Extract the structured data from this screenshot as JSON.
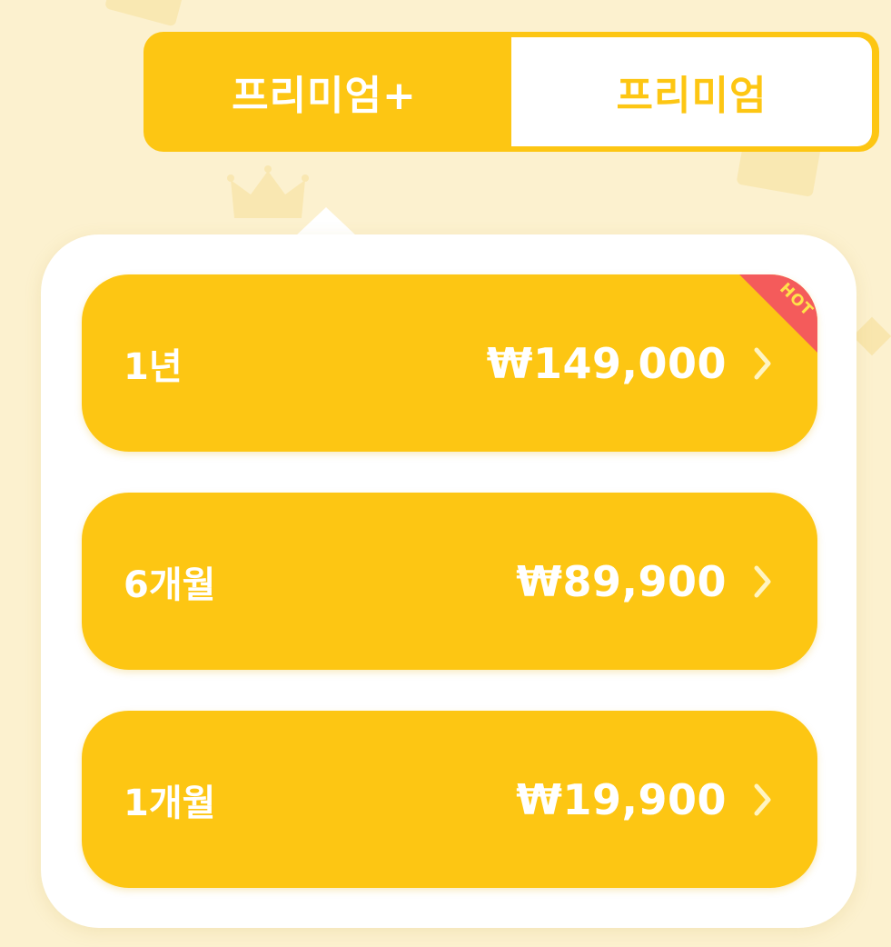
{
  "tabs": [
    {
      "label": "프리미엄+",
      "selected": true
    },
    {
      "label": "프리미엄",
      "selected": false
    }
  ],
  "plans": [
    {
      "label": "1년",
      "price": "₩149,000",
      "badge": "HOT"
    },
    {
      "label": "6개월",
      "price": "₩89,900"
    },
    {
      "label": "1개월",
      "price": "₩19,900"
    }
  ],
  "colors": {
    "accent": "#fdc613",
    "background": "#fcf1cf",
    "card": "#ffffff",
    "badge": "#f45b5b",
    "badge_text": "#ffe24a",
    "text_on_accent": "#ffffff"
  },
  "icons": {
    "chevron": "chevron-right-icon",
    "background": "crown-icon"
  }
}
